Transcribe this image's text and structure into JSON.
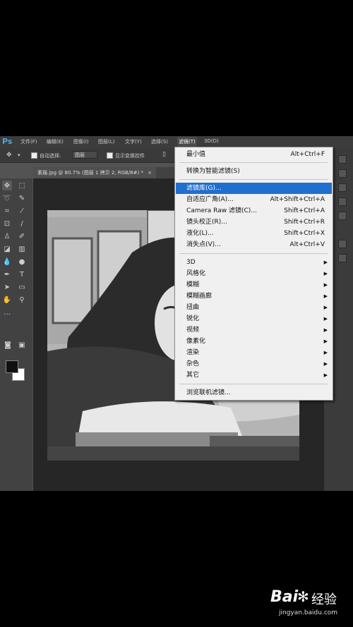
{
  "app": {
    "logo": "Ps"
  },
  "menubar": {
    "items": [
      "文件(F)",
      "编辑(E)",
      "图像(I)",
      "图层(L)",
      "文字(Y)",
      "选择(S)",
      "滤镜(T)",
      "3D(D)"
    ],
    "active_item": "滤镜(T)"
  },
  "options": {
    "auto_select_label": "自动选择:",
    "auto_select_value": "图层",
    "show_transform_label": "显示变换控件"
  },
  "document_tab": {
    "label": "素描.jpg @ 80.7% (图层 1 拷贝 2, RGB/8#) *",
    "close_glyph": "×"
  },
  "filter_menu": {
    "items": [
      {
        "label": "最小值",
        "shortcut": "Alt+Ctrl+F"
      },
      {
        "label": "转换为智能滤镜(S)",
        "shortcut": ""
      },
      {
        "label": "滤镜库(G)...",
        "shortcut": "",
        "highlighted": true
      },
      {
        "label": "自适应广角(A)...",
        "shortcut": "Alt+Shift+Ctrl+A"
      },
      {
        "label": "Camera Raw 滤镜(C)...",
        "shortcut": "Shift+Ctrl+A"
      },
      {
        "label": "镜头校正(R)...",
        "shortcut": "Shift+Ctrl+R"
      },
      {
        "label": "液化(L)...",
        "shortcut": "Shift+Ctrl+X"
      },
      {
        "label": "消失点(V)...",
        "shortcut": "Alt+Ctrl+V"
      },
      {
        "label": "3D",
        "submenu": true
      },
      {
        "label": "风格化",
        "submenu": true
      },
      {
        "label": "模糊",
        "submenu": true
      },
      {
        "label": "模糊画廊",
        "submenu": true
      },
      {
        "label": "扭曲",
        "submenu": true
      },
      {
        "label": "锐化",
        "submenu": true
      },
      {
        "label": "视频",
        "submenu": true
      },
      {
        "label": "像素化",
        "submenu": true
      },
      {
        "label": "渲染",
        "submenu": true
      },
      {
        "label": "杂色",
        "submenu": true
      },
      {
        "label": "其它",
        "submenu": true
      },
      {
        "label": "浏览联机滤镜...",
        "shortcut": ""
      }
    ]
  },
  "watermark": {
    "brand_left": "Bai",
    "brand_right": "经验",
    "url": "jingyan.baidu.com"
  },
  "colors": {
    "highlight": "#1f6fce",
    "ps_bg": "#535353",
    "menu_bg": "#f0f0f0"
  }
}
